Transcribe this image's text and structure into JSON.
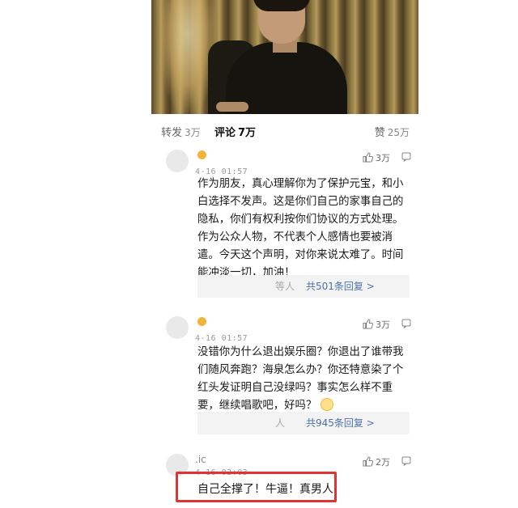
{
  "stats": {
    "repost": {
      "label": "转发",
      "count": "3万"
    },
    "comment": {
      "label": "评论",
      "count": "7万"
    },
    "like": {
      "label": "赞",
      "count": "25万"
    }
  },
  "comments": [
    {
      "time": "4-16 01:57",
      "likes": "3万",
      "text": "作为朋友，真心理解你为了保护元宝，和小白选择不发声。这是你们自己的家事自己的隐私，你们有权利按你们协议的方式处理。作为公众人物，不代表个人感情也要被消遣。今天这个声明，对你来说太难了。时间能冲淡一切，加油！",
      "reply_who": "等人",
      "reply_count": "共501条回复 >"
    },
    {
      "time": "4-16 01:57",
      "likes": "3万",
      "text": "没错你为什么退出娱乐圈？你退出了谁带我们随风奔跑？海泉怎么办？你还特意染了个红头发证明自己没绿吗？事实怎么样不重要，继续唱歌吧，好吗？",
      "reply_who": "人",
      "reply_count": "共945条回复 >"
    },
    {
      "username": ".ic",
      "time": "4-16 02:03",
      "likes": "2万",
      "text": "自己全撑了！牛逼！真男人"
    }
  ],
  "colors": {
    "highlight": "#e23232",
    "link": "#4d72a8"
  }
}
